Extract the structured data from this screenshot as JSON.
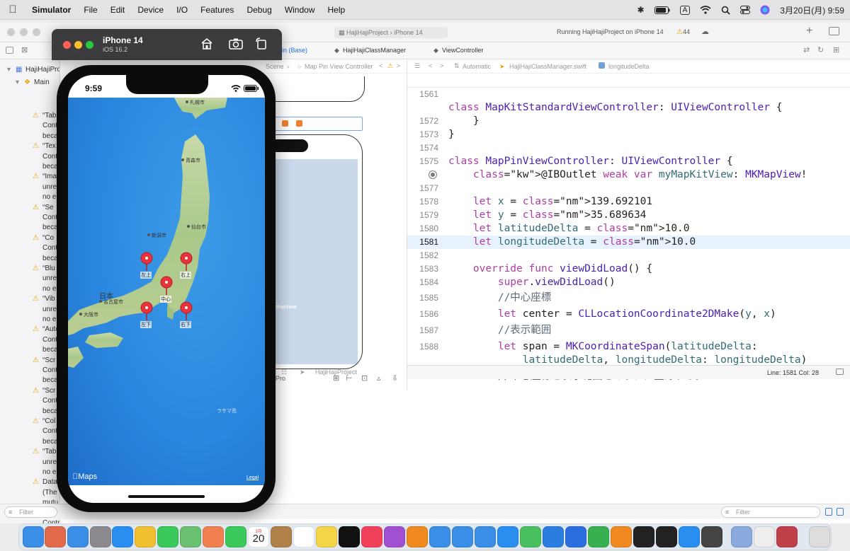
{
  "menubar": {
    "app_name": "Simulator",
    "items": [
      "Edit",
      "Device",
      "I/O",
      "Features",
      "Debug",
      "Window",
      "Help"
    ],
    "file": "File",
    "input_badge": "A",
    "clock": "3月20日(月)  9:59"
  },
  "xcode": {
    "breadcrumb_project": "HajiHajiProject",
    "breadcrumb_device": "iPhone 14",
    "run_status": "Running HajiHajiProject on iPhone 14",
    "warning_count": "44",
    "tabs": [
      "in (Base)",
      "HajiHajiClassManager",
      "ViewController"
    ],
    "jump_bar": [
      "Automatic",
      "HajiHajiClassManager.swift",
      "longitudeDelta"
    ],
    "scene_crumb": "Scene",
    "scene_path": "Map Pin View Controller",
    "mapview_label": "MapView",
    "ib_bottom_label": "Pro",
    "debug_crumb": "HajiHajiProject",
    "status": "Line: 1581  Col: 28",
    "filter_left": "Filter",
    "filter_right": "Filter"
  },
  "navigator": {
    "project": "HajiHajiProject",
    "group": "Main",
    "rows": [
      "“Tab",
      "Cont",
      "beca",
      "“Tex",
      "Cont",
      "beca",
      "“Ima",
      "unre",
      "no e",
      "“Se",
      "Cont",
      "beca",
      "“Co",
      "Cont",
      "beca",
      "“Blu",
      "unre",
      "no e",
      "“Vib",
      "unre",
      "no e",
      "“Auto",
      "Cont",
      "beca",
      "“Scr",
      "Cont",
      "beca",
      "“Scr",
      "Cont",
      "beca",
      "“Col",
      "Cont",
      "beca",
      "“Tab",
      "unre",
      "no e",
      "Data",
      "(The",
      "mutu",
      "“Auto",
      "Contr"
    ]
  },
  "code": {
    "sticky": {
      "ln": "1561",
      "parts": [
        [
          "kw",
          "class"
        ],
        [
          "",
          "·"
        ],
        [
          "ty",
          "MapKitStandardViewController"
        ],
        [
          "",
          ":·"
        ],
        [
          "ty",
          "UIViewController"
        ],
        [
          "",
          "·{"
        ]
      ]
    },
    "lines": [
      {
        "ln": "1572",
        "text": "    }"
      },
      {
        "ln": "1573",
        "text": "}"
      },
      {
        "ln": "1574",
        "text": ""
      },
      {
        "ln": "1575",
        "text": "class MapPinViewController: UIViewController {"
      },
      {
        "ln": "",
        "text": "    @IBOutlet weak var myMapKitView: MKMapView!"
      },
      {
        "ln": "1577",
        "text": ""
      },
      {
        "ln": "1578",
        "text": "    let x = 139.692101"
      },
      {
        "ln": "1579",
        "text": "    let y = 35.689634"
      },
      {
        "ln": "1580",
        "text": "    let latitudeDelta = 10.0"
      },
      {
        "ln": "1581",
        "text": "    let longitudeDelta = 10.0"
      },
      {
        "ln": "1582",
        "text": ""
      },
      {
        "ln": "1583",
        "text": "    override func viewDidLoad() {"
      },
      {
        "ln": "1584",
        "text": "        super.viewDidLoad()"
      },
      {
        "ln": "1585",
        "text": "        //中心座標"
      },
      {
        "ln": "1586",
        "text": "        let center = CLLocationCoordinate2DMake(y, x)"
      },
      {
        "ln": "1587",
        "text": "        //表示範囲"
      },
      {
        "ln": "1588",
        "text": "        let span = MKCoordinateSpan(latitudeDelta:"
      },
      {
        "ln": "",
        "text": "            latitudeDelta, longitudeDelta: longitudeDelta)"
      },
      {
        "ln": "1589",
        "text": "        //中心座標と表示範囲をマップに登録する。"
      }
    ]
  },
  "simulator": {
    "device": "iPhone 14",
    "os": "iOS 16.2",
    "time": "9:59",
    "maps_brand": "Maps",
    "legal": "Legal",
    "pins": [
      "左上",
      "右上",
      "中心",
      "左下",
      "右下"
    ],
    "cities": [
      "札幌市",
      "青森市",
      "仙台市",
      "新潟市",
      "名古屋市",
      "大阪市",
      "日本",
      "ラサマ島"
    ]
  },
  "dock": {
    "calendar_month": "3月",
    "calendar_day": "20"
  }
}
